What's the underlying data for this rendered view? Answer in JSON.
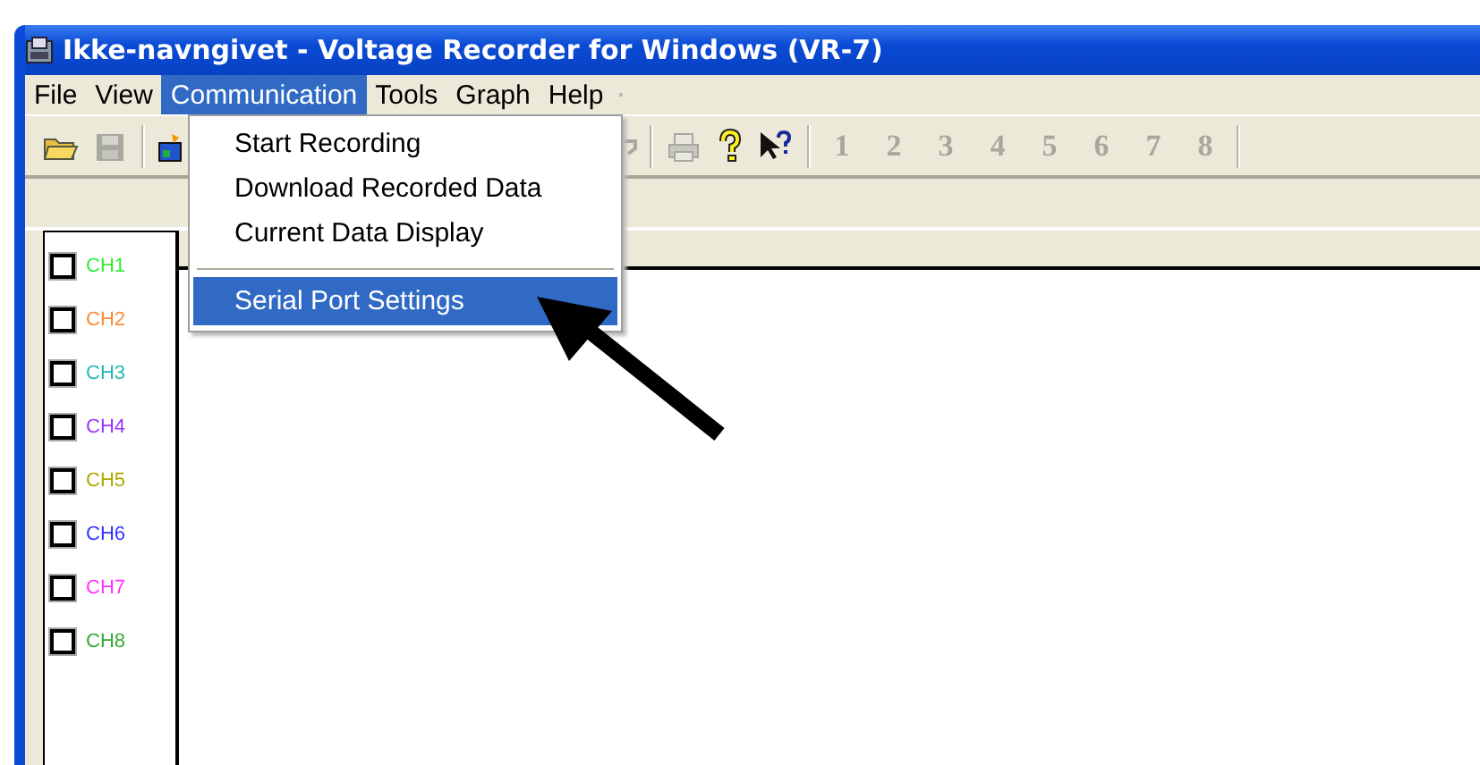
{
  "window": {
    "title": "Ikke-navngivet - Voltage Recorder for Windows (VR-7)"
  },
  "menu_bar": [
    {
      "label": "File",
      "selected": false
    },
    {
      "label": "View",
      "selected": false
    },
    {
      "label": "Communication",
      "selected": true
    },
    {
      "label": "Tools",
      "selected": false
    },
    {
      "label": "Graph",
      "selected": false
    },
    {
      "label": "Help",
      "selected": false
    }
  ],
  "toolbar": {
    "channel_buttons": [
      {
        "label": "1",
        "disabled": true
      },
      {
        "label": "2",
        "disabled": true
      },
      {
        "label": "3",
        "disabled": true
      },
      {
        "label": "4",
        "disabled": true
      },
      {
        "label": "5",
        "disabled": true
      },
      {
        "label": "6",
        "disabled": true
      },
      {
        "label": "7",
        "disabled": true
      },
      {
        "label": "8",
        "disabled": true
      }
    ]
  },
  "dropdown_menu": {
    "items": [
      {
        "kind": "item",
        "label": "Start Recording",
        "selected": false
      },
      {
        "kind": "item",
        "label": "Download Recorded Data",
        "selected": false
      },
      {
        "kind": "item",
        "label": "Current Data Display",
        "selected": false
      },
      {
        "kind": "separator"
      },
      {
        "kind": "item",
        "label": "Serial Port Settings",
        "selected": true
      }
    ]
  },
  "channels": [
    {
      "label": "CH1",
      "color": "#33ee33",
      "checked": false
    },
    {
      "label": "CH2",
      "color": "#ff8833",
      "checked": false
    },
    {
      "label": "CH3",
      "color": "#22b8b8",
      "checked": false
    },
    {
      "label": "CH4",
      "color": "#9933ff",
      "checked": false
    },
    {
      "label": "CH5",
      "color": "#b0a800",
      "checked": false
    },
    {
      "label": "CH6",
      "color": "#3333ff",
      "checked": false
    },
    {
      "label": "CH7",
      "color": "#ff33ff",
      "checked": false
    },
    {
      "label": "CH8",
      "color": "#33aa33",
      "checked": false
    }
  ]
}
